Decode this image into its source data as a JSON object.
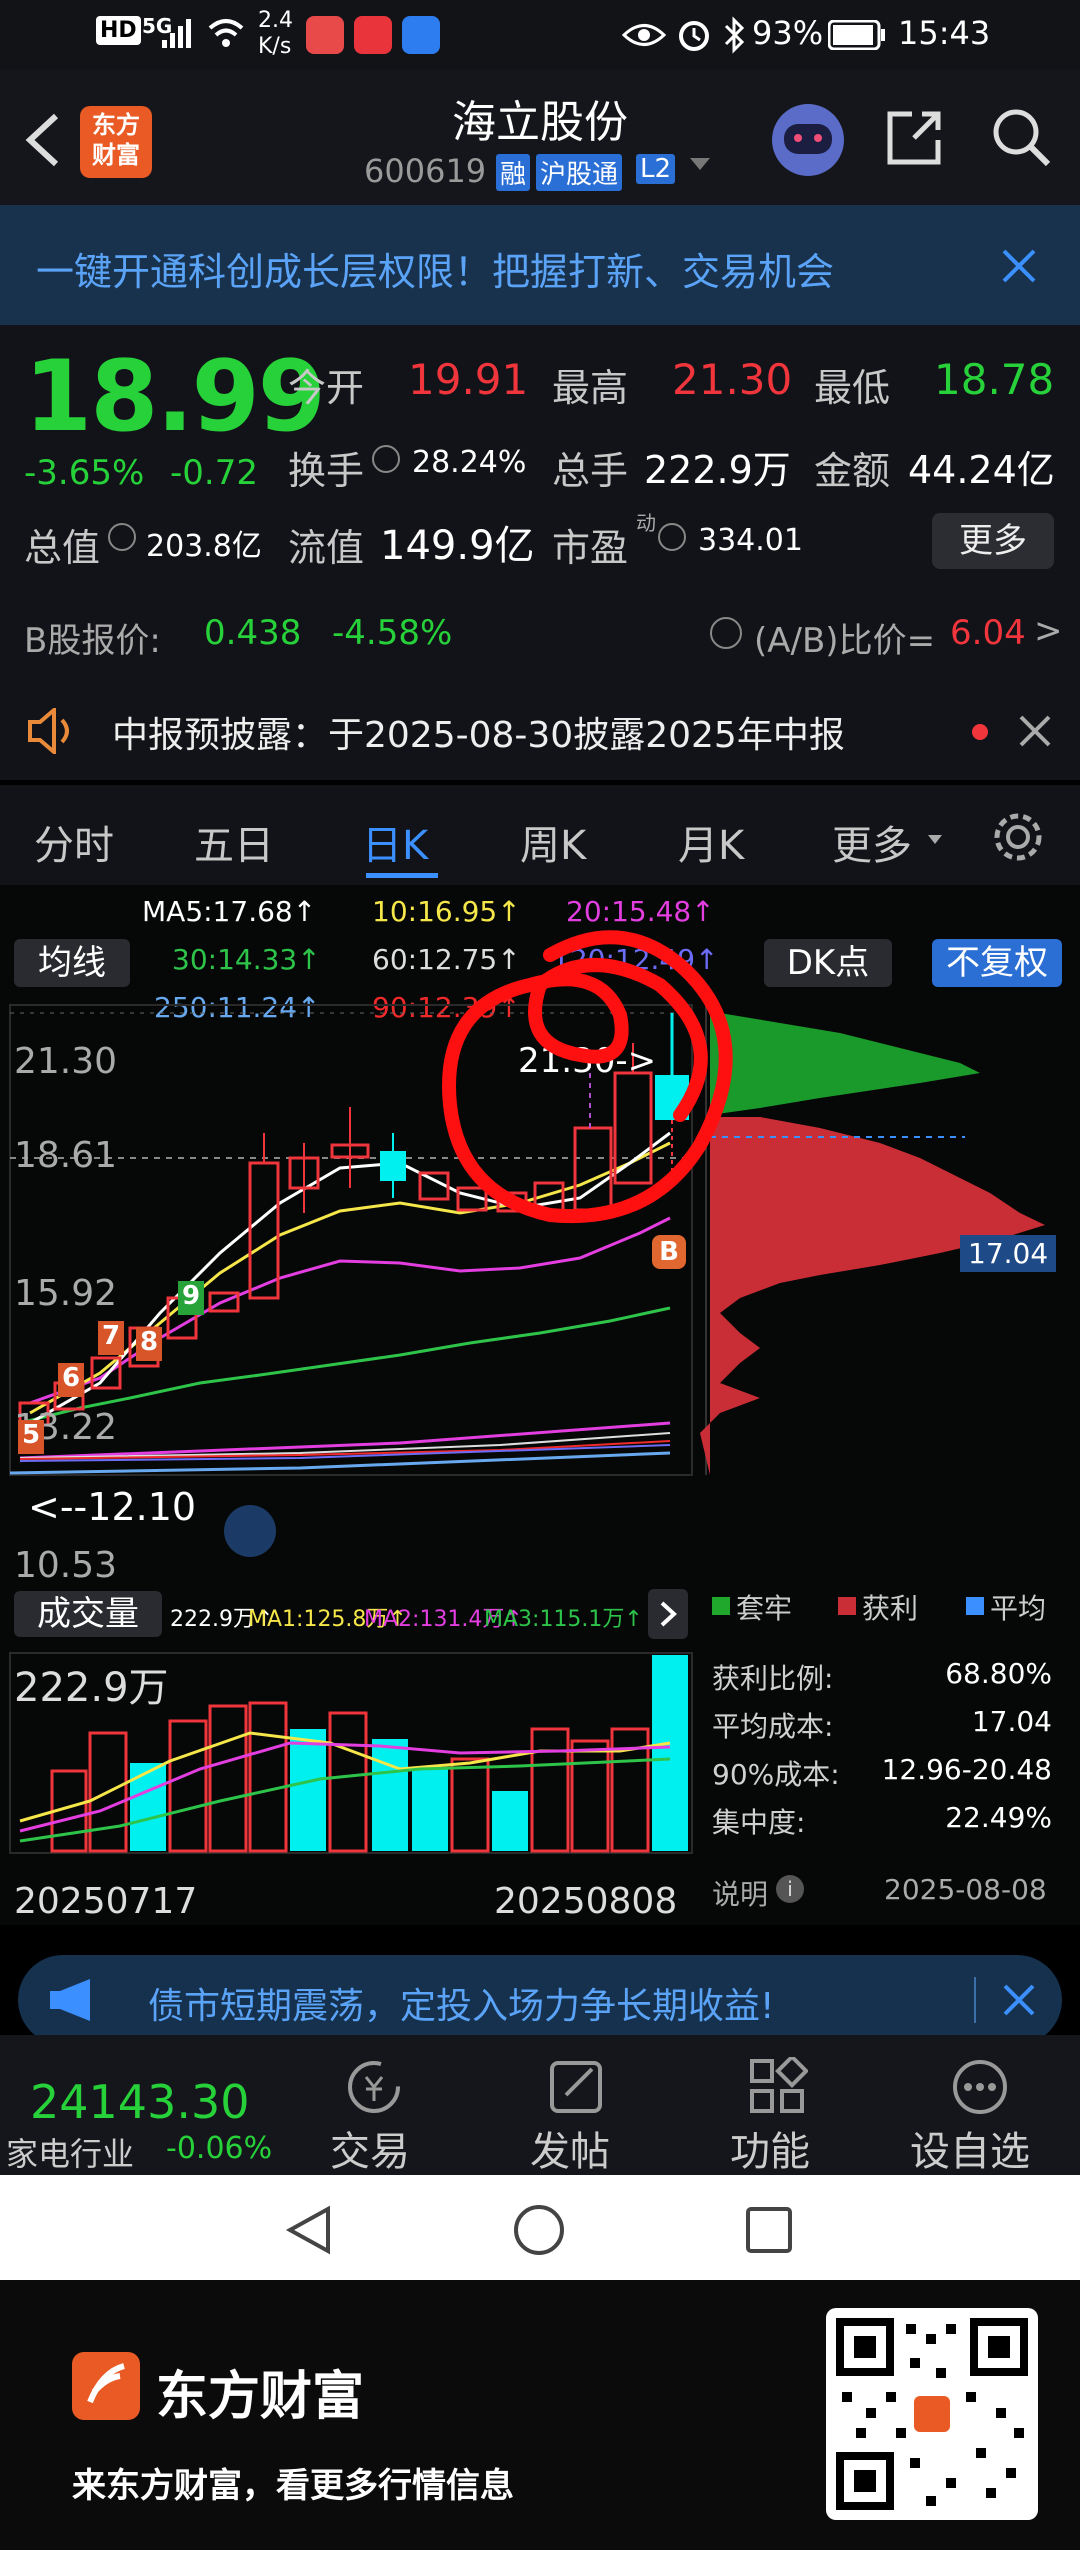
{
  "status_bar": {
    "hd": "HD",
    "signal": "5G",
    "speed_value": "2.4",
    "speed_unit": "K/s",
    "battery": "93%",
    "time": "15:43"
  },
  "header": {
    "logo_line1": "东方",
    "logo_line2": "财富",
    "title": "海立股份",
    "code": "600619",
    "tag_margin": "融",
    "tag_connect": "沪股通",
    "tag_level": "L2"
  },
  "banner": {
    "text": "一键开通科创成长层权限！把握打新、交易机会"
  },
  "quote": {
    "price": "18.99",
    "change_pct": "-3.65%",
    "change_abs": "-0.72",
    "open_label": "今开",
    "open": "19.91",
    "high_label": "最高",
    "high": "21.30",
    "low_label": "最低",
    "low": "18.78",
    "turnover_label": "换手",
    "turnover": "28.24%",
    "volume_label": "总手",
    "volume": "222.9万",
    "amount_label": "金额",
    "amount": "44.24亿",
    "mktcap_label": "总值",
    "mktcap": "203.8亿",
    "float_label": "流值",
    "float": "149.9亿",
    "pe_label": "市盈",
    "pe_sup": "动",
    "pe": "334.01",
    "more": "更多"
  },
  "b_share": {
    "label": "B股报价:",
    "price": "0.438",
    "change": "-4.58%",
    "ratio_label": "(A/B)比价=",
    "ratio": "6.04",
    "arrow": ">"
  },
  "notice": {
    "text": "中报预披露：于2025-08-30披露2025年中报"
  },
  "tabs": [
    {
      "label": "分时"
    },
    {
      "label": "五日"
    },
    {
      "label": "日K"
    },
    {
      "label": "周K"
    },
    {
      "label": "月K"
    },
    {
      "label": "更多"
    }
  ],
  "ma_legend": {
    "ma5": "MA5:17.68↑",
    "ma10": "10:16.95↑",
    "ma20": "20:15.48↑",
    "ma30": "30:14.33↑",
    "ma60": "60:12.75↑",
    "ma120": "120:12.49↑",
    "ma250": "250:11.24↑",
    "ma90": "90:12.39↑"
  },
  "chart_controls": {
    "ma_button": "均线",
    "dk_button": "DK点",
    "adjust_button": "不复权"
  },
  "kline": {
    "y_labels": [
      "21.30",
      "18.61",
      "15.92",
      "13.22",
      "10.53"
    ],
    "high_marker": "21.30->",
    "low_marker": "<--12.10",
    "cost_marker": "17.04",
    "b_signal": "B",
    "seq_digits": [
      "5",
      "6",
      "7",
      "8",
      "9"
    ]
  },
  "volume_panel": {
    "label": "成交量",
    "vol": "222.9万↑",
    "ma1": "MA1:125.8万↑",
    "ma2": "MA2:131.4万↑",
    "ma3": "MA3:115.1万↑",
    "y_label": "222.9万",
    "date_start": "20250717",
    "date_end": "20250808"
  },
  "chip_panel": {
    "legend_trapped": "套牢",
    "legend_profit": "获利",
    "legend_avg": "平均",
    "rows": [
      {
        "label": "获利比例:",
        "value": "68.80%"
      },
      {
        "label": "平均成本:",
        "value": "17.04"
      },
      {
        "label": "90%成本:",
        "value": "12.96-20.48"
      },
      {
        "label": "集中度:",
        "value": "22.49%"
      }
    ],
    "note_label": "说明",
    "date": "2025-08-08"
  },
  "ad_bar": {
    "text": "债市短期震荡，定投入场力争长期收益!"
  },
  "bottom_bar": {
    "index_value": "24143.30",
    "index_name": "家电行业",
    "index_change": "-0.06%",
    "trade": "交易",
    "post": "发帖",
    "functions": "功能",
    "watchlist": "设自选"
  },
  "footer": {
    "brand": "东方财富",
    "slogan": "来东方财富，看更多行情信息"
  },
  "colors": {
    "up": "#f0353d",
    "down": "#27d13a",
    "accent": "#3b8fff",
    "cyan": "#00f0f0"
  }
}
